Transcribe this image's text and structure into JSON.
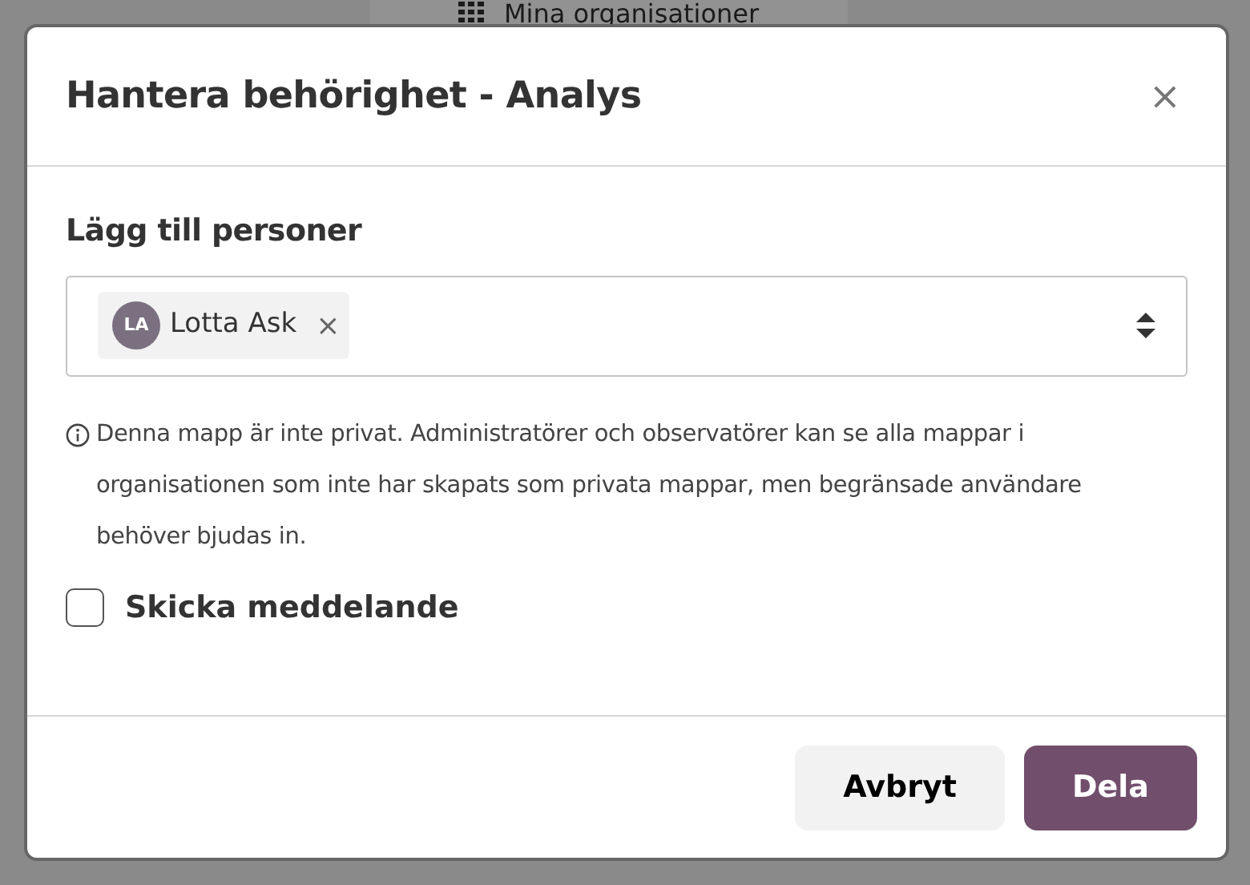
{
  "background": {
    "org_button": "Mina organisationer"
  },
  "dialog": {
    "title": "Hantera behörighet - Analys",
    "close": "×",
    "section_label": "Lägg till personer",
    "people": [
      {
        "initials": "LA",
        "name": "Lotta Ask",
        "remove": "×"
      }
    ],
    "info": "Denna mapp är inte privat. Administratörer och observatörer kan se alla mappar i organisationen som inte har skapats som privata mappar, men begränsade användare behöver bjudas in.",
    "notify": {
      "label": "Skicka meddelande",
      "checked": false
    },
    "buttons": [
      {
        "label": "Avbryt",
        "kind": "secondary"
      },
      {
        "label": "Dela",
        "kind": "primary"
      }
    ]
  }
}
